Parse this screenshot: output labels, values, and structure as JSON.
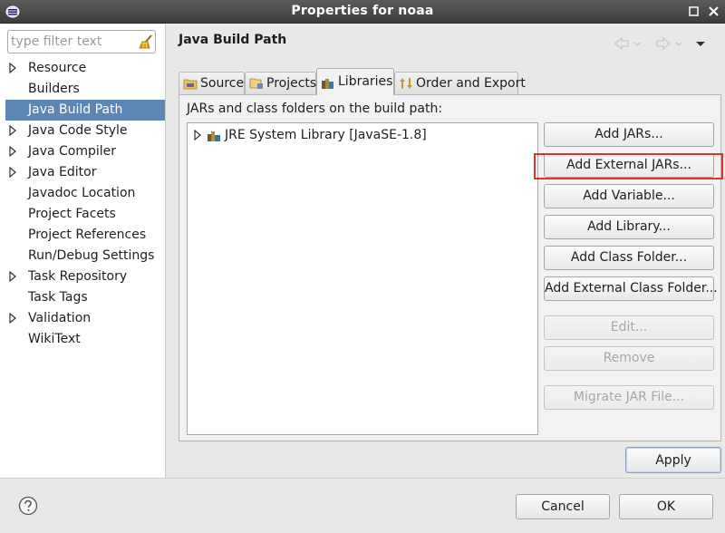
{
  "window": {
    "title": "Properties for noaa"
  },
  "filter": {
    "placeholder": "type filter text"
  },
  "sidebar": {
    "items": [
      {
        "label": "Resource",
        "expandable": true
      },
      {
        "label": "Builders",
        "expandable": false
      },
      {
        "label": "Java Build Path",
        "expandable": false,
        "selected": true
      },
      {
        "label": "Java Code Style",
        "expandable": true
      },
      {
        "label": "Java Compiler",
        "expandable": true
      },
      {
        "label": "Java Editor",
        "expandable": true
      },
      {
        "label": "Javadoc Location",
        "expandable": false
      },
      {
        "label": "Project Facets",
        "expandable": false
      },
      {
        "label": "Project References",
        "expandable": false
      },
      {
        "label": "Run/Debug Settings",
        "expandable": false
      },
      {
        "label": "Task Repository",
        "expandable": true
      },
      {
        "label": "Task Tags",
        "expandable": false
      },
      {
        "label": "Validation",
        "expandable": true
      },
      {
        "label": "WikiText",
        "expandable": false
      }
    ]
  },
  "page": {
    "title": "Java Build Path"
  },
  "tabs": [
    {
      "label": "Source",
      "icon": "source-folder-icon"
    },
    {
      "label": "Projects",
      "icon": "projects-icon"
    },
    {
      "label": "Libraries",
      "icon": "libraries-icon",
      "active": true
    },
    {
      "label": "Order and Export",
      "icon": "order-export-icon"
    }
  ],
  "libraries": {
    "caption": "JARs and class folders on the build path:",
    "entries": [
      {
        "label": "JRE System Library [JavaSE-1.8]",
        "icon": "jre-library-icon"
      }
    ],
    "buttons": [
      {
        "label": "Add JARs...",
        "enabled": true
      },
      {
        "label": "Add External JARs...",
        "enabled": true,
        "highlighted": true
      },
      {
        "label": "Add Variable...",
        "enabled": true
      },
      {
        "label": "Add Library...",
        "enabled": true
      },
      {
        "label": "Add Class Folder...",
        "enabled": true
      },
      {
        "label": "Add External Class Folder...",
        "enabled": true
      },
      {
        "label": "Edit...",
        "enabled": false
      },
      {
        "label": "Remove",
        "enabled": false
      },
      {
        "label": "Migrate JAR File...",
        "enabled": false
      }
    ]
  },
  "actions": {
    "apply": "Apply",
    "cancel": "Cancel",
    "ok": "OK"
  },
  "colors": {
    "selection": "#5c86b3",
    "highlight_box": "#e03232",
    "titlebar": "#3c3c3c"
  }
}
